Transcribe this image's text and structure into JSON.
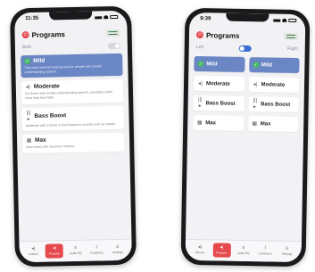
{
  "left": {
    "status_time": "11:35",
    "title": "Programs",
    "side_label": "Both",
    "programs": [
      {
        "name": "Mild",
        "desc": "The most common hearing loss for people with trouble understanding speech.",
        "icon": "check-icon"
      },
      {
        "name": "Moderate",
        "desc": "For those with trouble understanding speech, providing a little more help than Mild.",
        "icon": "speaker-wave-icon"
      },
      {
        "name": "Bass Boost",
        "desc": "Moderate with a boost in low frequency sounds such as vowels.",
        "icon": "bass-bars-icon"
      },
      {
        "name": "Max",
        "desc": "Gain boost with maximum volume.",
        "icon": "grid-icon"
      }
    ]
  },
  "right": {
    "status_time": "9:39",
    "title": "Programs",
    "left_label": "Left",
    "right_label": "Right",
    "programs_left": [
      "Mild",
      "Moderate",
      "Bass Boost",
      "Max"
    ],
    "programs_right": [
      "Mild",
      "Moderate",
      "Bass Boost",
      "Max"
    ]
  },
  "tabs": [
    {
      "label": "Volume",
      "icon": "speaker-icon"
    },
    {
      "label": "Program",
      "icon": "waveform-icon"
    },
    {
      "label": "Audio EQ",
      "icon": "eq-icon"
    },
    {
      "label": "Conditions",
      "icon": "chart-icon"
    },
    {
      "label": "Settings",
      "icon": "person-icon"
    }
  ],
  "colors": {
    "accent_red": "#e5484d",
    "selected_blue": "#6b86c4",
    "check_green": "#45b867"
  }
}
